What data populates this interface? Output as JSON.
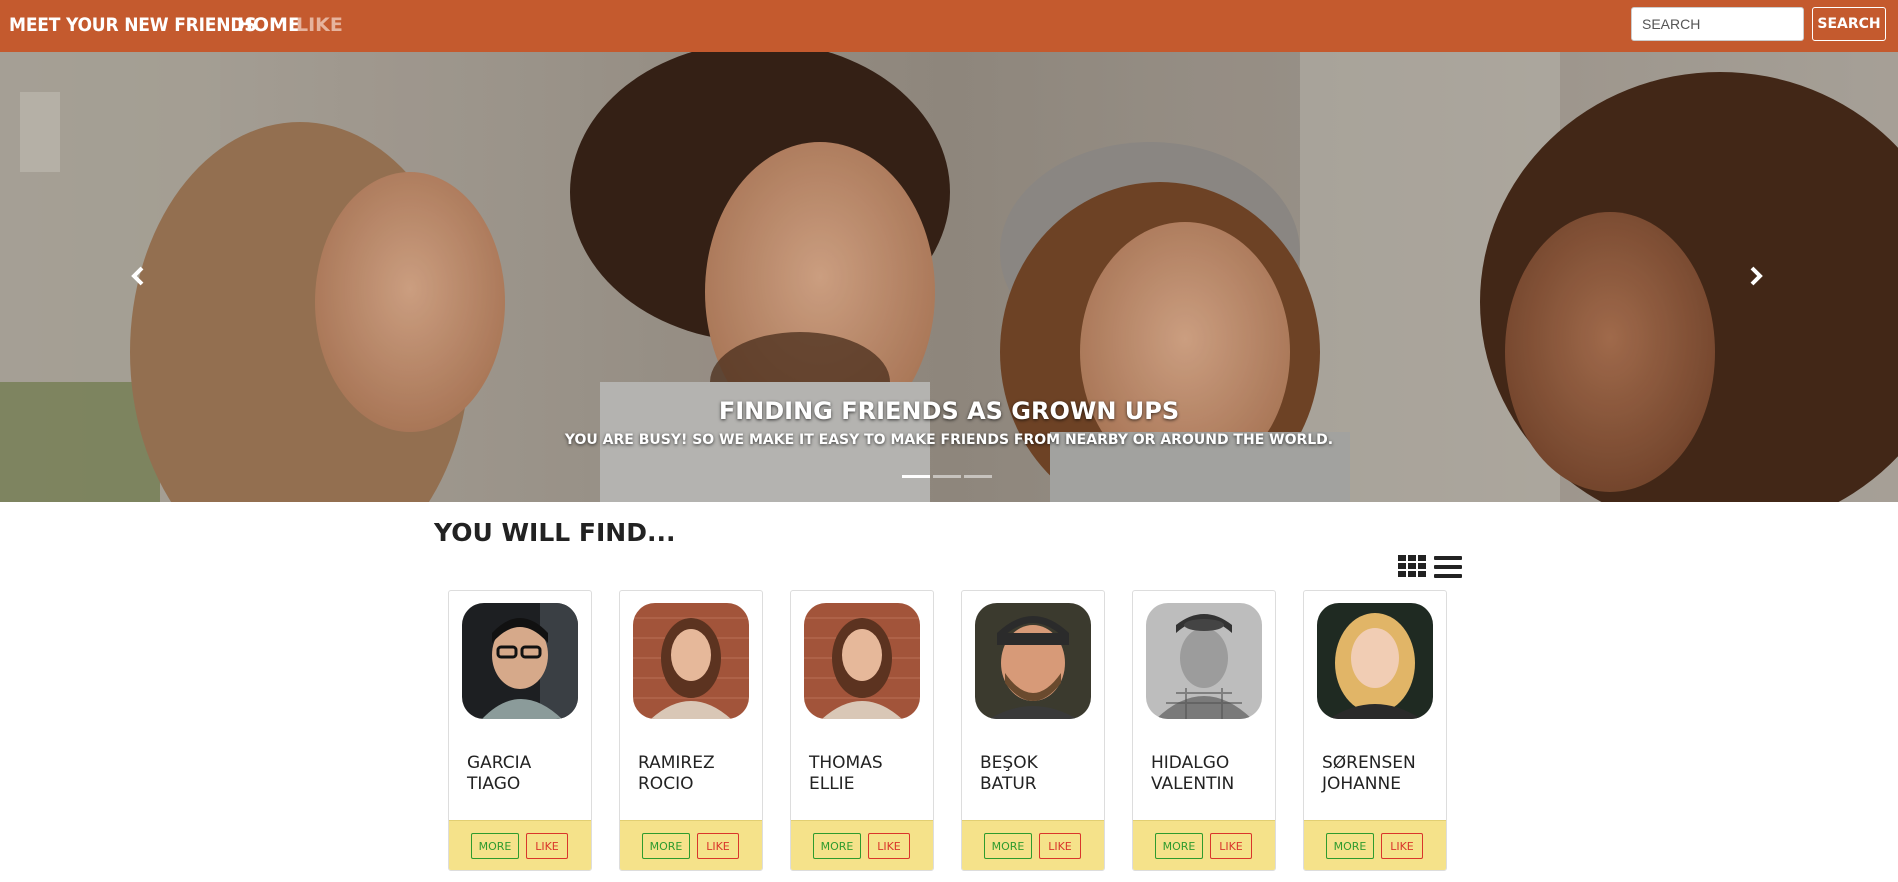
{
  "navbar": {
    "brand": "MEET YOUR NEW FRIENDS",
    "links": [
      {
        "label": "HOME"
      },
      {
        "label": "LIKE"
      }
    ],
    "search": {
      "placeholder": "SEARCH",
      "button_label": "SEARCH"
    },
    "background_color": "#c45a2e"
  },
  "hero": {
    "title": "FINDING FRIENDS AS GROWN UPS",
    "subtitle": "YOU ARE BUSY! SO WE MAKE IT EASY TO MAKE FRIENDS FROM NEARBY OR AROUND THE WORLD.",
    "prev_icon": "chevron-left-icon",
    "next_icon": "chevron-right-icon",
    "slides_count": 3,
    "active_slide": 1
  },
  "section": {
    "title": "YOU WILL FIND...",
    "view_icons": [
      "grid-view-icon",
      "list-view-icon"
    ]
  },
  "friends": [
    {
      "last": "GARCIA",
      "first": "TIAGO",
      "more_label": "MORE",
      "like_label": "LIKE"
    },
    {
      "last": "RAMIREZ",
      "first": "ROCIO",
      "more_label": "MORE",
      "like_label": "LIKE"
    },
    {
      "last": "THOMAS",
      "first": "ELLIE",
      "more_label": "MORE",
      "like_label": "LIKE"
    },
    {
      "last": "BEŞOK",
      "first": "BATUR",
      "more_label": "MORE",
      "like_label": "LIKE"
    },
    {
      "last": "HIDALGO",
      "first": "VALENTIN",
      "more_label": "MORE",
      "like_label": "LIKE"
    },
    {
      "last": "SØRENSEN",
      "first": "JOHANNE",
      "more_label": "MORE",
      "like_label": "LIKE"
    }
  ],
  "colors": {
    "card_footer": "#f5e28a",
    "more_button": "#2e9b2e",
    "like_button": "#d9352b"
  }
}
